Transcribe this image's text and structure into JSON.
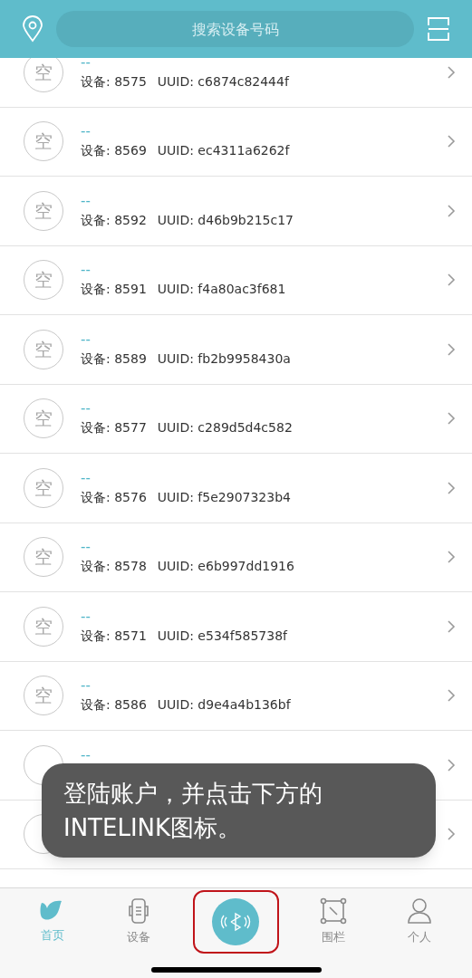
{
  "header": {
    "search_placeholder": "搜索设备号码"
  },
  "devices": [
    {
      "avatar": "空",
      "name": "--",
      "device": "设备: 8575",
      "uuid": "UUID: c6874c82444f"
    },
    {
      "avatar": "空",
      "name": "--",
      "device": "设备: 8569",
      "uuid": "UUID: ec4311a6262f"
    },
    {
      "avatar": "空",
      "name": "--",
      "device": "设备: 8592",
      "uuid": "UUID: d46b9b215c17"
    },
    {
      "avatar": "空",
      "name": "--",
      "device": "设备: 8591",
      "uuid": "UUID: f4a80ac3f681"
    },
    {
      "avatar": "空",
      "name": "--",
      "device": "设备: 8589",
      "uuid": "UUID: fb2b9958430a"
    },
    {
      "avatar": "空",
      "name": "--",
      "device": "设备: 8577",
      "uuid": "UUID: c289d5d4c582"
    },
    {
      "avatar": "空",
      "name": "--",
      "device": "设备: 8576",
      "uuid": "UUID: f5e2907323b4"
    },
    {
      "avatar": "空",
      "name": "--",
      "device": "设备: 8578",
      "uuid": "UUID: e6b997dd1916"
    },
    {
      "avatar": "空",
      "name": "--",
      "device": "设备: 8571",
      "uuid": "UUID: e534f585738f"
    },
    {
      "avatar": "空",
      "name": "--",
      "device": "设备: 8586",
      "uuid": "UUID: d9e4a4b136bf"
    },
    {
      "name": "--"
    }
  ],
  "toast": "登陆账户，并点击下方的INTELINK图标。",
  "tabs": [
    {
      "kind": "home",
      "label": "首页",
      "selected": true
    },
    {
      "kind": "device",
      "label": "设备",
      "selected": false
    },
    {
      "kind": "bluetooth",
      "highlighted": true
    },
    {
      "kind": "fence",
      "label": "围栏",
      "selected": false
    },
    {
      "kind": "person",
      "label": "个人",
      "selected": false
    }
  ]
}
